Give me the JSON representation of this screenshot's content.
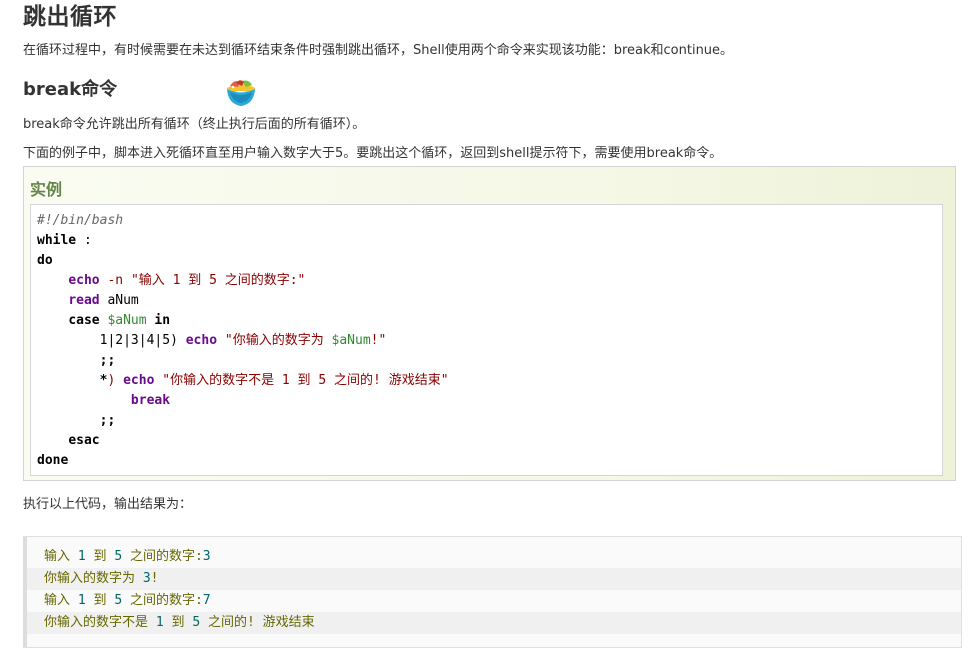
{
  "page": {
    "title": "跳出循环",
    "intro": "在循环过程中，有时候需要在未达到循环结束条件时强制跳出循环，Shell使用两个命令来实现该功能：break和continue。"
  },
  "section": {
    "title": "break命令",
    "desc": "break命令允许跳出所有循环（终止执行后面的所有循环）。",
    "example_desc": "下面的例子中，脚本进入死循环直至用户输入数字大于5。要跳出这个循环，返回到shell提示符下，需要使用break命令。"
  },
  "example": {
    "title": "实例",
    "code": {
      "shebang": "#!/bin/bash",
      "while_kw": "while",
      "while_rest": " :",
      "do_kw": "do",
      "echo1_cmd": "echo",
      "echo1_opt": "-n",
      "echo1_str": "\"输入 1 到 5 之间的数字:\"",
      "read_cmd": "read",
      "read_var": "aNum",
      "case_kw": "case",
      "case_var": "$aNum",
      "in_kw": "in",
      "pattern1": "1|2|3|4|5",
      "paren": ")",
      "echo2_cmd": "echo",
      "echo2_str_a": "\"你输入的数字为 ",
      "echo2_var": "$aNum",
      "echo2_str_b": "!\"",
      "dsemi1": ";;",
      "star": "*",
      "paren2": ")",
      "echo3_cmd": "echo",
      "echo3_str": "\"你输入的数字不是 1 到 5 之间的! 游戏结束\"",
      "break_cmd": "break",
      "dsemi2": ";;",
      "esac_kw": "esac",
      "done_kw": "done"
    }
  },
  "output": {
    "desc": "执行以上代码，输出结果为：",
    "lines": [
      {
        "text": "输入 ",
        "n1": "1",
        "mid": " 到 ",
        "n2": "5",
        "tail": " 之间的数字:",
        "n3": "3"
      },
      {
        "text": "你输入的数字为 ",
        "n1": "3",
        "tail": "!"
      },
      {
        "text": "输入 ",
        "n1": "1",
        "mid": " 到 ",
        "n2": "5",
        "tail": " 之间的数字:",
        "n3": "7"
      },
      {
        "text": "你输入的数字不是 ",
        "n1": "1",
        "mid": " 到 ",
        "n2": "5",
        "tail": " 之间的! 游戏结束"
      }
    ]
  },
  "icons": {
    "emoji": "colorful-bowl-icon"
  }
}
